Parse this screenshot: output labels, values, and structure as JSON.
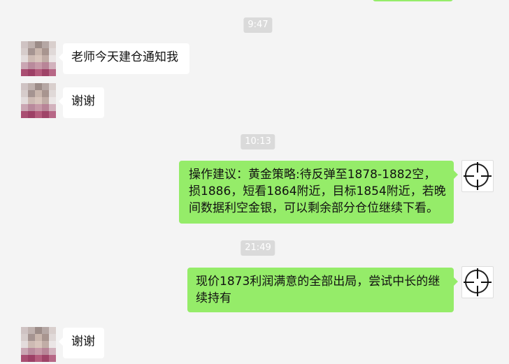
{
  "colors": {
    "background": "#f4f4f4",
    "outgoing_bubble": "#95ec69",
    "incoming_bubble": "#ffffff",
    "timestamp_bg": "#dadada"
  },
  "timestamps": [
    "9:47",
    "10:13",
    "21:49"
  ],
  "messages": [
    {
      "direction": "in",
      "text": "老师今天建仓通知我"
    },
    {
      "direction": "in",
      "text": "谢谢"
    },
    {
      "direction": "out",
      "text": "操作建议：黄金策略:待反弹至1878-1882空，损1886，短看1864附近，目标1854附近，若晚间数据利空金银，可以剩余部分仓位继续下看。"
    },
    {
      "direction": "out",
      "text": "现价1873利润满意的全部出局，尝试中长的继续持有"
    },
    {
      "direction": "in",
      "text": "谢谢"
    }
  ],
  "avatars": {
    "contact": "pixelated-photo-avatar",
    "self": "crosshair-avatar"
  }
}
